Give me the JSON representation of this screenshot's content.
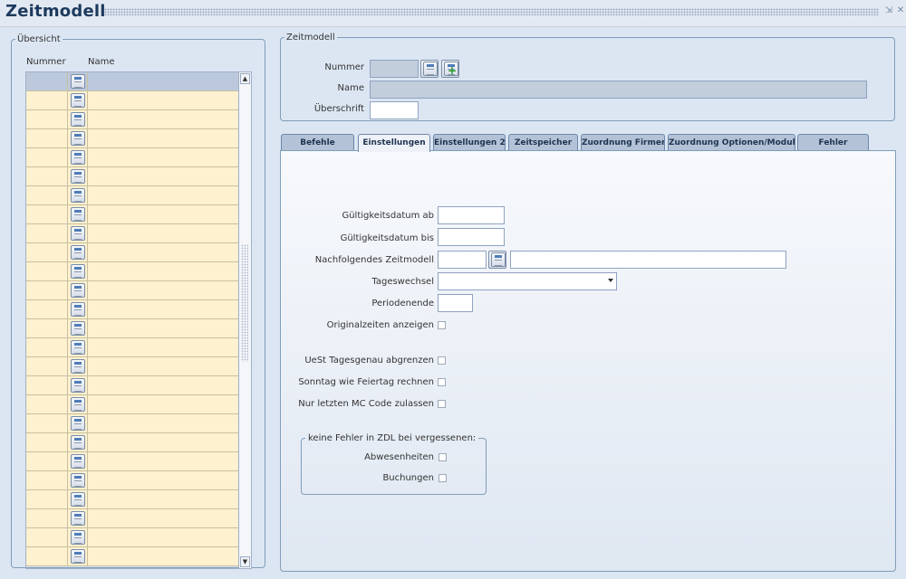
{
  "window": {
    "title": "Zeitmodell"
  },
  "overview": {
    "legend": "Übersicht",
    "col_number": "Nummer",
    "col_name": "Name",
    "row_count": 26
  },
  "zeitmodell": {
    "legend": "Zeitmodell",
    "nummer_label": "Nummer",
    "nummer_value": "",
    "name_label": "Name",
    "name_value": "",
    "ueberschrift_label": "Überschrift",
    "ueberschrift_value": ""
  },
  "tabs": [
    {
      "label": "Befehle",
      "active": false
    },
    {
      "label": "Einstellungen",
      "active": true
    },
    {
      "label": "Einstellungen 2",
      "active": false
    },
    {
      "label": "Zeitspeicher",
      "active": false
    },
    {
      "label": "Zuordnung Firmen",
      "active": false
    },
    {
      "label": "Zuordnung Optionen/Module",
      "active": false
    },
    {
      "label": "Fehler",
      "active": false
    }
  ],
  "settings": {
    "gueltig_ab_label": "Gültigkeitsdatum ab",
    "gueltig_ab_value": "",
    "gueltig_bis_label": "Gültigkeitsdatum bis",
    "gueltig_bis_value": "",
    "nachfolgend_label": "Nachfolgendes Zeitmodell",
    "nachfolgend_code": "",
    "nachfolgend_name": "",
    "tageswechsel_label": "Tageswechsel",
    "tageswechsel_value": "",
    "periodenende_label": "Periodenende",
    "periodenende_value": "",
    "originalzeiten_label": "Originalzeiten anzeigen",
    "originalzeiten_checked": false,
    "uest_label": "UeSt Tagesgenau abgrenzen",
    "uest_checked": false,
    "sonntag_label": "Sonntag wie Feiertag rechnen",
    "sonntag_checked": false,
    "mc_code_label": "Nur letzten MC Code zulassen",
    "mc_code_checked": false,
    "zdl_legend": "keine Fehler in ZDL bei vergessenen:",
    "abwesenheiten_label": "Abwesenheiten",
    "abwesenheiten_checked": false,
    "buchungen_label": "Buchungen",
    "buchungen_checked": false
  },
  "colors": {
    "window_bg": "#dce6f3",
    "title_text": "#1c3a5e",
    "row_bg": "#fdf1cf",
    "row_selected_bg": "#bcc9dc",
    "readonly_input_bg": "#c3cedd",
    "tab_bg": "#b3c2d6",
    "add_icon": "#1e9a2a"
  }
}
